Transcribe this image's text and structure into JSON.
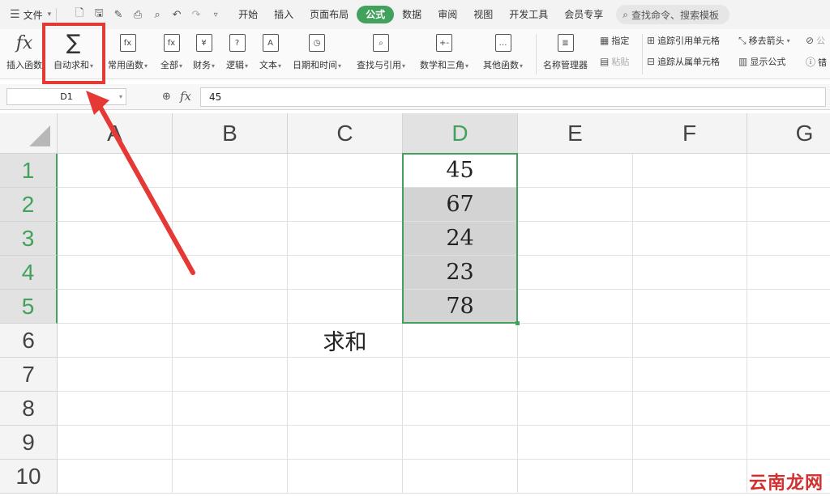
{
  "menubar": {
    "file_label": "文件",
    "tabs": [
      "开始",
      "插入",
      "页面布局",
      "公式",
      "数据",
      "审阅",
      "视图",
      "开发工具",
      "会员专享"
    ],
    "active_tab": "公式",
    "search_placeholder": "查找命令、搜索模板"
  },
  "ribbon": {
    "insert_function": "插入函数",
    "autosum": "自动求和",
    "common_functions": "常用函数",
    "all": "全部",
    "finance": "财务",
    "logic": "逻辑",
    "text": "文本",
    "datetime": "日期和时间",
    "lookup": "查找与引用",
    "math": "数学和三角",
    "other": "其他函数",
    "name_manager": "名称管理器",
    "specify": "指定",
    "paste": "粘贴",
    "trace_precedents": "追踪引用单元格",
    "trace_dependents": "追踪从属单元格",
    "remove_arrows": "移去箭头",
    "show_formulas": "显示公式",
    "error_check_partial": "错",
    "formula_eval_partial": "公"
  },
  "formula_bar": {
    "name_box": "D1",
    "value": "45"
  },
  "sheet": {
    "columns": [
      "A",
      "B",
      "C",
      "D",
      "E",
      "F",
      "G"
    ],
    "rows": [
      "1",
      "2",
      "3",
      "4",
      "5",
      "6",
      "7",
      "8",
      "9",
      "10"
    ],
    "selected_column": "D",
    "cells": {
      "D1": "45",
      "D2": "67",
      "D3": "24",
      "D4": "23",
      "D5": "78",
      "C6": "求和"
    }
  },
  "colors": {
    "accent_green": "#41a15d",
    "highlight_red": "#e53935"
  },
  "watermark": "云南龙网"
}
